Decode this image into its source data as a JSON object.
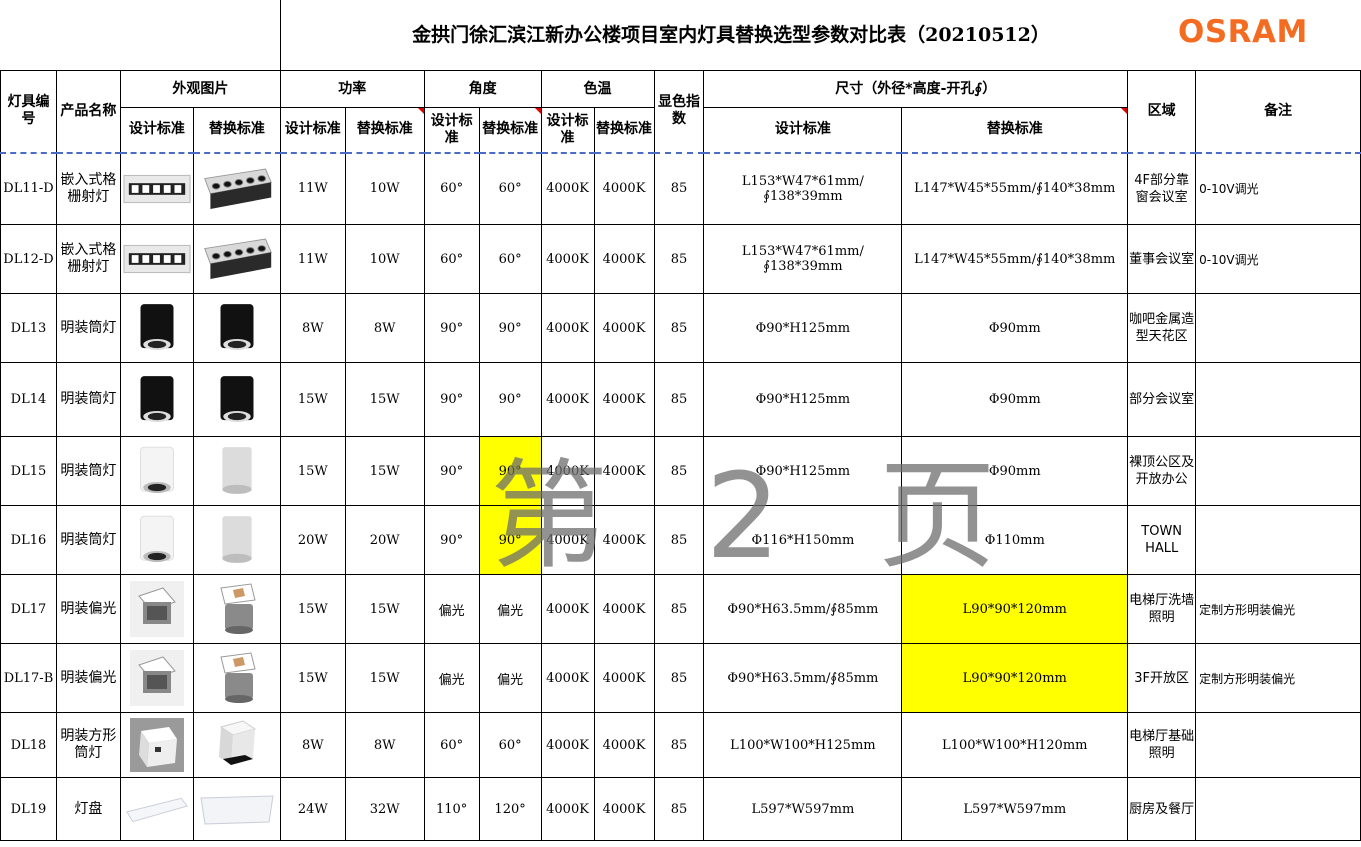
{
  "title": "金拱门徐汇滨江新办公楼项目室内灯具替换选型参数对比表（20210512）",
  "logo": "OSRAM",
  "watermark": "第 2 页",
  "headers": {
    "id": "灯具编号",
    "name": "产品名称",
    "image": "外观图片",
    "power": "功率",
    "angle": "角度",
    "cct": "色温",
    "cri": "显色指数",
    "size": "尺寸（外径*高度-开孔∮）",
    "area": "区域",
    "remark": "备注",
    "design": "设计标准",
    "replace": "替换标准"
  },
  "rows": [
    {
      "id": "DL11-D",
      "name": "嵌入式格栅射灯",
      "img": "grille",
      "p_d": "11W",
      "p_r": "10W",
      "a_d": "60°",
      "a_r": "60°",
      "c_d": "4000K",
      "c_r": "4000K",
      "cri": "85",
      "s_d": "L153*W47*61mm/∮138*39mm",
      "s_r": "L147*W45*55mm/∮140*38mm",
      "area": "4F部分靠窗会议室",
      "remark": "0-10V调光"
    },
    {
      "id": "DL12-D",
      "name": "嵌入式格栅射灯",
      "img": "grille",
      "p_d": "11W",
      "p_r": "10W",
      "a_d": "60°",
      "a_r": "60°",
      "c_d": "4000K",
      "c_r": "4000K",
      "cri": "85",
      "s_d": "L153*W47*61mm/∮138*39mm",
      "s_r": "L147*W45*55mm/∮140*38mm",
      "area": "董事会议室",
      "remark": "0-10V调光"
    },
    {
      "id": "DL13",
      "name": "明装筒灯",
      "img": "black-can",
      "p_d": "8W",
      "p_r": "8W",
      "a_d": "90°",
      "a_r": "90°",
      "c_d": "4000K",
      "c_r": "4000K",
      "cri": "85",
      "s_d": "Φ90*H125mm",
      "s_r": "Φ90mm",
      "area": "咖吧金属造型天花区",
      "remark": ""
    },
    {
      "id": "DL14",
      "name": "明装筒灯",
      "img": "black-can",
      "p_d": "15W",
      "p_r": "15W",
      "a_d": "90°",
      "a_r": "90°",
      "c_d": "4000K",
      "c_r": "4000K",
      "cri": "85",
      "s_d": "Φ90*H125mm",
      "s_r": "Φ90mm",
      "area": "部分会议室",
      "remark": ""
    },
    {
      "id": "DL15",
      "name": "明装筒灯",
      "img": "white-can",
      "p_d": "15W",
      "p_r": "15W",
      "a_d": "90°",
      "a_r": "90°",
      "c_d": "4000K",
      "c_r": "4000K",
      "cri": "85",
      "s_d": "Φ90*H125mm",
      "s_r": "Φ90mm",
      "area": "裸顶公区及开放办公",
      "remark": ""
    },
    {
      "id": "DL16",
      "name": "明装筒灯",
      "img": "white-can",
      "p_d": "20W",
      "p_r": "20W",
      "a_d": "90°",
      "a_r": "90°",
      "c_d": "4000K",
      "c_r": "4000K",
      "cri": "85",
      "s_d": "Φ116*H150mm",
      "s_r": "Φ110mm",
      "area": "TOWN HALL",
      "remark": ""
    },
    {
      "id": "DL17",
      "name": "明装偏光",
      "img": "wallwash",
      "p_d": "15W",
      "p_r": "15W",
      "a_d": "偏光",
      "a_r": "偏光",
      "c_d": "4000K",
      "c_r": "4000K",
      "cri": "85",
      "s_d": "Φ90*H63.5mm/∮85mm",
      "s_r": "L90*90*120mm",
      "area": "电梯厅洗墙照明",
      "remark": "定制方形明装偏光"
    },
    {
      "id": "DL17-B",
      "name": "明装偏光",
      "img": "wallwash",
      "p_d": "15W",
      "p_r": "15W",
      "a_d": "偏光",
      "a_r": "偏光",
      "c_d": "4000K",
      "c_r": "4000K",
      "cri": "85",
      "s_d": "Φ90*H63.5mm/∮85mm",
      "s_r": "L90*90*120mm",
      "area": "3F开放区",
      "remark": "定制方形明装偏光"
    },
    {
      "id": "DL18",
      "name": "明装方形筒灯",
      "img": "square",
      "p_d": "8W",
      "p_r": "8W",
      "a_d": "60°",
      "a_r": "60°",
      "c_d": "4000K",
      "c_r": "4000K",
      "cri": "85",
      "s_d": "L100*W100*H125mm",
      "s_r": "L100*W100*H120mm",
      "area": "电梯厅基础照明",
      "remark": ""
    },
    {
      "id": "DL19",
      "name": "灯盘",
      "img": "panel",
      "p_d": "24W",
      "p_r": "32W",
      "a_d": "110°",
      "a_r": "120°",
      "c_d": "4000K",
      "c_r": "4000K",
      "cri": "85",
      "s_d": "L597*W597mm",
      "s_r": "L597*W597mm",
      "area": "厨房及餐厅",
      "remark": ""
    }
  ],
  "colors": {
    "logo": "#f36c21",
    "highlight": "#ffff00",
    "comment": "#e00000"
  }
}
